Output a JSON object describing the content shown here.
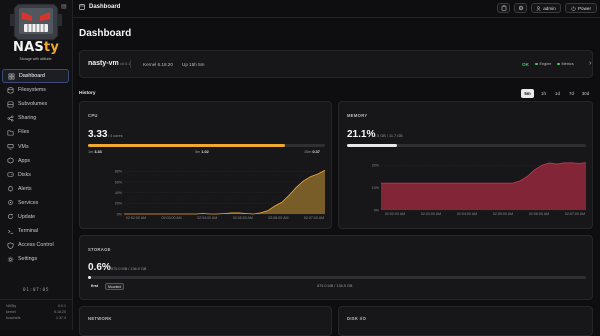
{
  "sidebar": {
    "brand_main": "NAS",
    "brand_accent": "ty",
    "tagline": "Storage with attitude.",
    "items": [
      {
        "label": "Dashboard",
        "icon": "dashboard-icon",
        "active": true
      },
      {
        "label": "Filesystems",
        "icon": "filesystems-icon"
      },
      {
        "label": "Subvolumes",
        "icon": "subvolumes-icon"
      },
      {
        "label": "Sharing",
        "icon": "sharing-icon"
      },
      {
        "label": "Files",
        "icon": "files-icon"
      },
      {
        "label": "VMs",
        "icon": "vms-icon"
      },
      {
        "label": "Apps",
        "icon": "apps-icon"
      },
      {
        "label": "Disks",
        "icon": "disks-icon"
      },
      {
        "label": "Alerts",
        "icon": "alerts-icon"
      },
      {
        "label": "Services",
        "icon": "services-icon"
      },
      {
        "label": "Update",
        "icon": "update-icon"
      },
      {
        "label": "Terminal",
        "icon": "terminal-icon"
      },
      {
        "label": "Access Control",
        "icon": "access-control-icon"
      },
      {
        "label": "Settings",
        "icon": "settings-icon"
      }
    ],
    "clock": "01:07:05",
    "versions": [
      {
        "name": "NASty",
        "value": "0.0.1"
      },
      {
        "name": "kernel",
        "value": "6.18.20"
      },
      {
        "name": "bcachefs",
        "value": "1.37.4"
      }
    ]
  },
  "topbar": {
    "title": "Dashboard",
    "admin_label": "admin",
    "power_label": "Power"
  },
  "page_title": "Dashboard",
  "vm": {
    "name": "nasty-vm",
    "version": "v0.0.1",
    "kernel": "Kernel 6.18.20",
    "uptime": "Up 15h 5m",
    "status": "OK",
    "engine": "Engine",
    "metrics": "Metrics"
  },
  "history": {
    "label": "History",
    "ranges": [
      "5m",
      "1h",
      "1d",
      "7d",
      "30d"
    ],
    "selected": "5m"
  },
  "cpu": {
    "label": "CPU",
    "value": "3.33",
    "cores": "/ 4 cores",
    "fill": 0.83,
    "load": [
      {
        "name": "1m",
        "value": "3.33"
      },
      {
        "name": "5m",
        "value": "1.02"
      },
      {
        "name": "15m",
        "value": "0.37"
      }
    ]
  },
  "memory": {
    "label": "MEMORY",
    "value": "21.1%",
    "detail": "2.5 GB / 11.7 GB",
    "fill": 0.211
  },
  "storage": {
    "label": "STORAGE",
    "value": "0.6%",
    "detail": "875.0 MB / 136.9 GB",
    "fill": 0.006,
    "pool_name": "first",
    "pool_badge": "Mounted",
    "pool_detail": "875.0 MB / 136.9 GB"
  },
  "network": {
    "label": "NETWORK"
  },
  "disk_io": {
    "label": "DISK I/O"
  },
  "colors": {
    "accent": "#f0a830",
    "mem": "#9e2a3f",
    "ok": "#4cc46b"
  },
  "chart_data": [
    {
      "type": "area",
      "title": "CPU",
      "x": [
        "02:02:00 AM",
        "02:03:00 AM",
        "02:04:00 AM",
        "02:05:00 AM",
        "02:06:00 AM",
        "02:07:00 AM"
      ],
      "y_ticks": [
        "0%",
        "20%",
        "40%",
        "60%",
        "80%"
      ],
      "ylim": [
        0,
        90
      ],
      "values": [
        0,
        0,
        0,
        0,
        0,
        0,
        0,
        0,
        0,
        0,
        0,
        1,
        0,
        0,
        1,
        2,
        2,
        1,
        0,
        2,
        6,
        15,
        22,
        35,
        50,
        62,
        70,
        75,
        82
      ],
      "color": "#f0a830"
    },
    {
      "type": "area",
      "title": "MEMORY",
      "x": [
        "02:02:00 AM",
        "02:03:00 AM",
        "02:04:00 AM",
        "02:05:00 AM",
        "02:06:00 AM",
        "02:07:00 AM"
      ],
      "y_ticks": [
        "0%",
        "10%",
        "20%"
      ],
      "ylim": [
        0,
        25
      ],
      "values": [
        12,
        12,
        12,
        12,
        12,
        12,
        12,
        12,
        12,
        12,
        12,
        12,
        12,
        12,
        12,
        12,
        12,
        12,
        12,
        13,
        15,
        18,
        20,
        21,
        20.5,
        21,
        21.1,
        20.8,
        21.1
      ],
      "color": "#9e2a3f"
    }
  ]
}
